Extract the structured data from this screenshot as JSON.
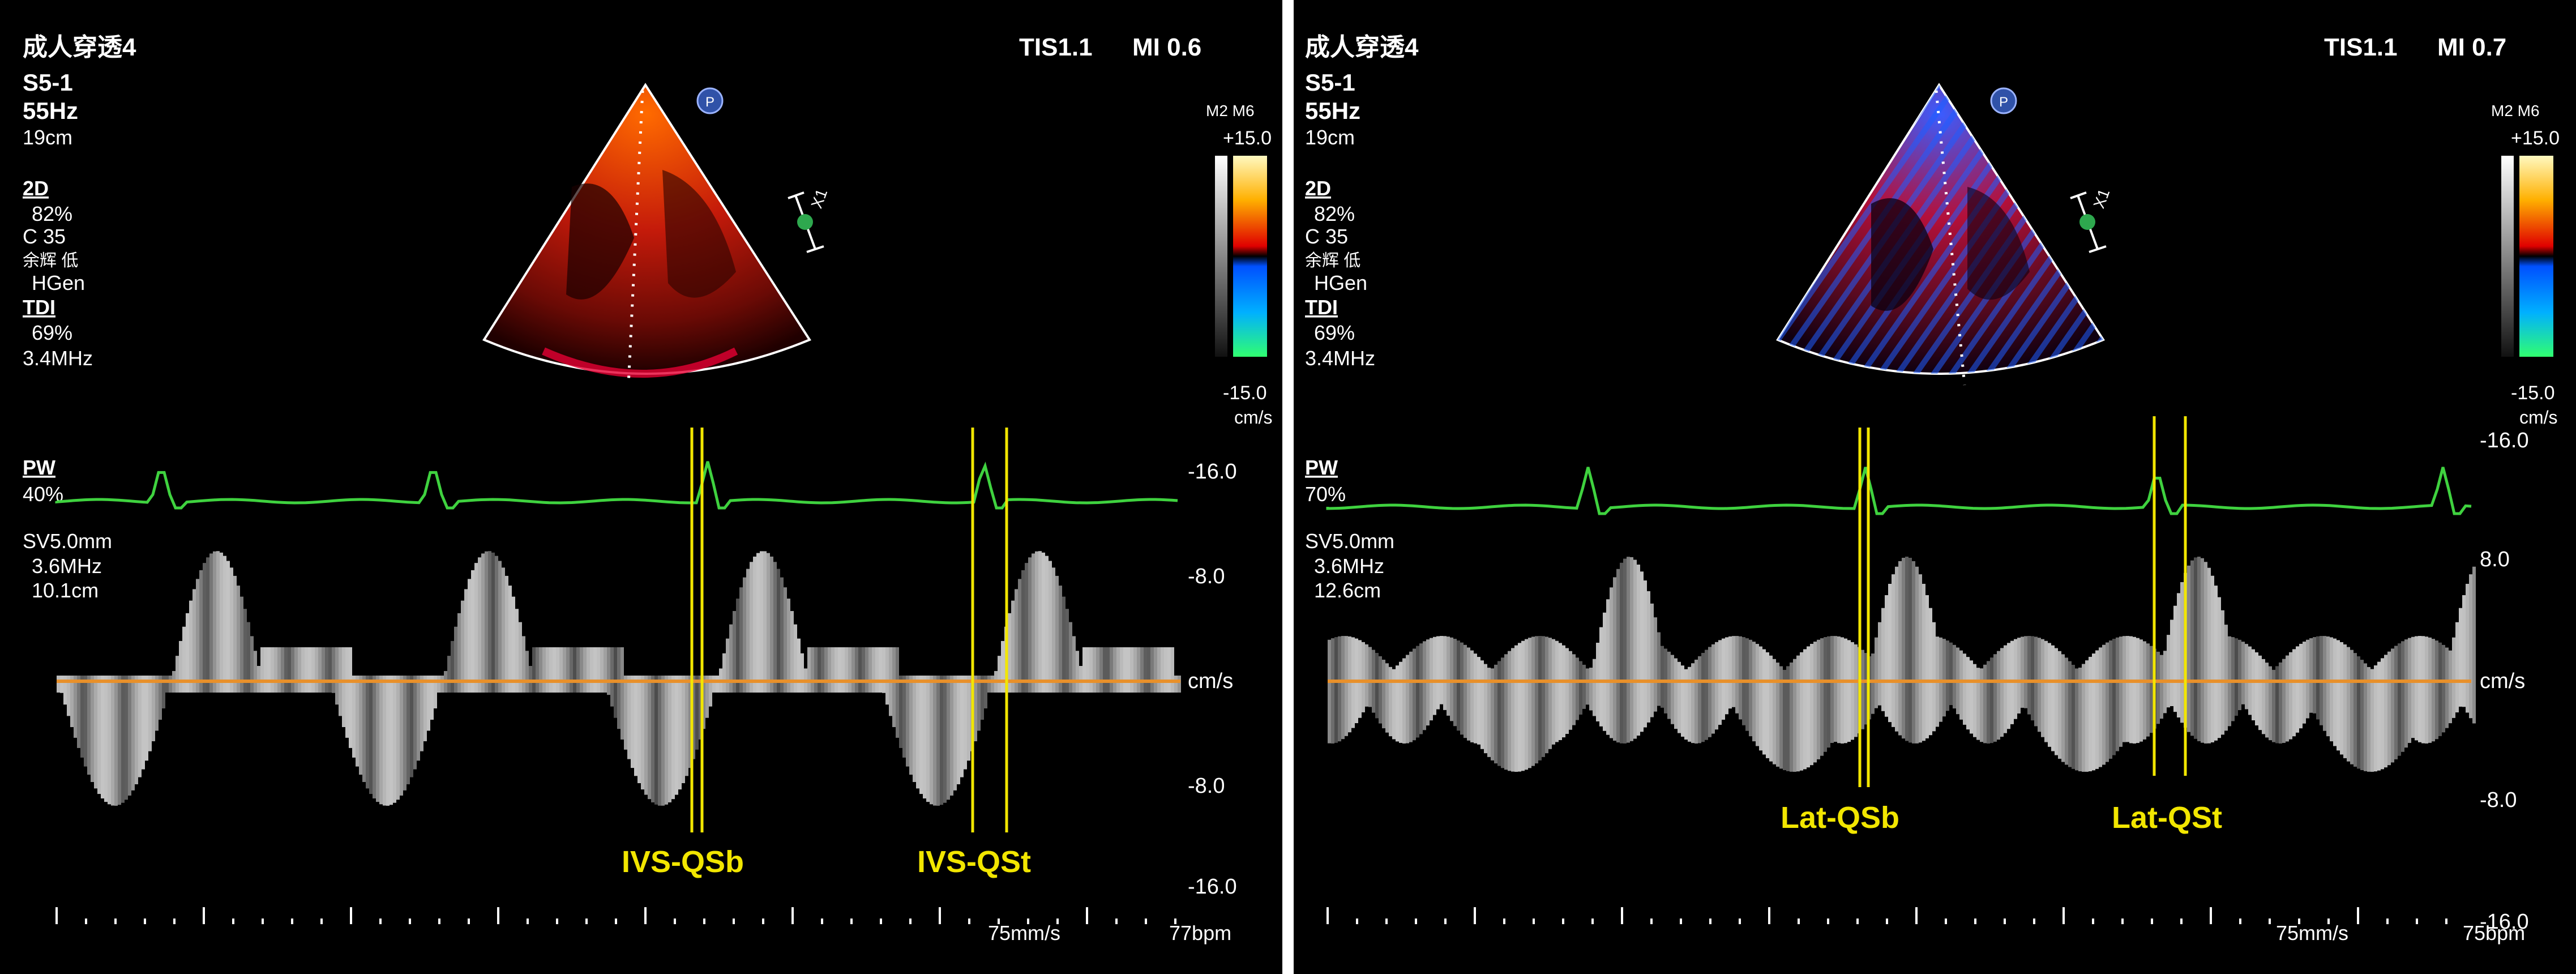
{
  "panels": [
    {
      "preset": "成人穿透4",
      "tis": "TIS1.1",
      "mi": "MI 0.6",
      "probe": "S5-1",
      "frame_rate": "55Hz",
      "depth": "19cm",
      "mode_2d": "2D",
      "gain_2d": "82%",
      "compression": "C 35",
      "persist": "余辉 低",
      "harmonic": "HGen",
      "mode_tdi": "TDI",
      "gain_tdi": "69%",
      "tdi_freq": "3.4MHz",
      "map_label": "M2 M6",
      "scale_top": "+15.0",
      "scale_bottom": "-15.0",
      "scale_unit": "cm/s",
      "mode_pw": "PW",
      "gain_pw": "40%",
      "sv": "SV5.0mm",
      "pw_freq": "3.6MHz",
      "pw_depth": "10.1cm",
      "ticks": [
        "-16.0",
        "-8.0",
        "cm/s",
        "-8.0",
        "-16.0"
      ],
      "sweep": "75mm/s",
      "hr": "77bpm",
      "marker_1": "IVS-QSb",
      "marker_2": "IVS-QSt",
      "scale_badge": "X1",
      "p_icon": "P"
    },
    {
      "preset": "成人穿透4",
      "tis": "TIS1.1",
      "mi": "MI 0.7",
      "probe": "S5-1",
      "frame_rate": "55Hz",
      "depth": "19cm",
      "mode_2d": "2D",
      "gain_2d": "82%",
      "compression": "C 35",
      "persist": "余辉 低",
      "harmonic": "HGen",
      "mode_tdi": "TDI",
      "gain_tdi": "69%",
      "tdi_freq": "3.4MHz",
      "map_label": "M2 M6",
      "scale_top": "+15.0",
      "scale_bottom": "-15.0",
      "scale_unit": "cm/s",
      "mode_pw": "PW",
      "gain_pw": "70%",
      "sv": "SV5.0mm",
      "pw_freq": "3.6MHz",
      "pw_depth": "12.6cm",
      "ticks": [
        "-16.0",
        "8.0",
        "cm/s",
        "-8.0",
        "-16.0"
      ],
      "sweep": "75mm/s",
      "hr": "75bpm",
      "marker_1": "Lat-QSb",
      "marker_2": "Lat-QSt",
      "scale_badge": "X1",
      "p_icon": "P"
    }
  ],
  "colors": {
    "ecg": "#3fd23f",
    "baseline": "#e8902a",
    "marker": "#f2e600",
    "doppler": "#d9d9d9"
  }
}
